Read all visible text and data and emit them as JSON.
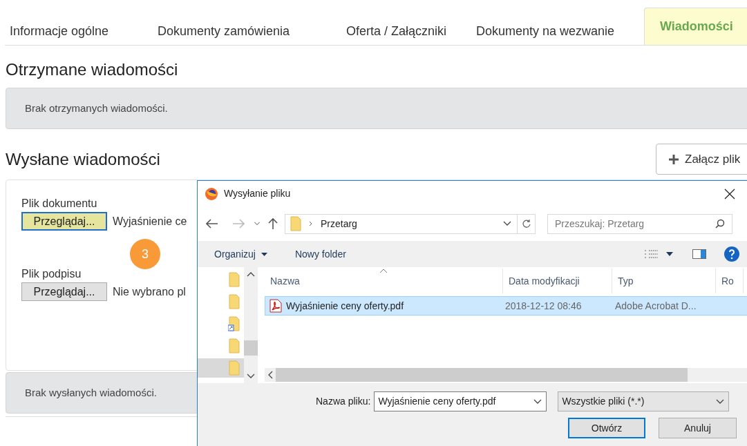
{
  "tabs": [
    {
      "label": "Informacje ogólne",
      "selected": false
    },
    {
      "label": "Dokumenty zamówienia",
      "selected": false
    },
    {
      "label": "Oferta / Załączniki",
      "selected": false
    },
    {
      "label": "Dokumenty na wezwanie",
      "selected": false
    },
    {
      "label": "Wiadomości",
      "selected": true
    }
  ],
  "received": {
    "title": "Otrzymane wiadomości",
    "empty_text": "Brak otrzymanych wiadomości."
  },
  "sent": {
    "title": "Wysłane wiadomości",
    "attach_button": "Załącz plik",
    "empty_text": "Brak wysłanych wiadomości.",
    "fields": [
      {
        "label": "Plik dokumentu",
        "button": "Przeglądaj...",
        "value": "Wyjaśnienie ce",
        "focused": true
      },
      {
        "label": "Plik podpisu",
        "button": "Przeglądaj...",
        "value": "Nie wybrano pl",
        "focused": false
      }
    ]
  },
  "step_badge": "3",
  "dialog": {
    "title": "Wysyłanie pliku",
    "path": "Przetarg",
    "search_placeholder": "Przeszukaj: Przetarg",
    "toolbar": {
      "organize": "Organizuj",
      "new_folder": "Nowy folder"
    },
    "nav_items": [
      {
        "kind": "folder",
        "selected": false
      },
      {
        "kind": "folder",
        "selected": false
      },
      {
        "kind": "shortcut",
        "selected": false
      },
      {
        "kind": "folder",
        "selected": false
      },
      {
        "kind": "folder",
        "selected": true
      }
    ],
    "columns": [
      "Nazwa",
      "Data modyfikacji",
      "Typ",
      "Ro"
    ],
    "files": [
      {
        "name": "Wyjaśnienie ceny oferty.pdf",
        "date": "2018-12-12 08:46",
        "type": "Adobe Acrobat D...",
        "selected": true
      }
    ],
    "filename_label": "Nazwa pliku:",
    "filename": "Wyjaśnienie ceny oferty.pdf",
    "filter": "Wszystkie pliki (*.*)",
    "open_button": "Otwórz",
    "cancel_button": "Anuluj"
  }
}
